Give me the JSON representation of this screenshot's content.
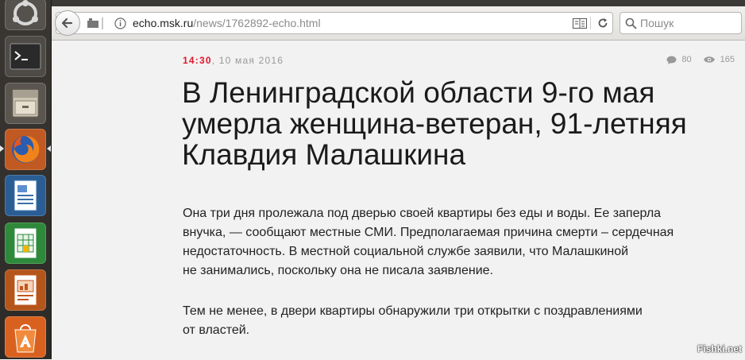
{
  "browser": {
    "url_host": "echo.msk.ru",
    "url_path": "/news/1762892-echo.html",
    "search_placeholder": "Пошук"
  },
  "article": {
    "time": "14:30",
    "date": ", 10 мая 2016",
    "comments_count": "80",
    "views_count": "165",
    "headline_lines": [
      "В Ленинградской области 9-го мая",
      "умерла женщина-ветеран, 91-летняя",
      "Клавдия Малашкина"
    ],
    "paragraph1_lines": [
      "Она три дня пролежала под дверью своей квартиры без еды и воды. Ее заперла",
      "внучка, — сообщают местные СМИ. Предполагаемая причина смерти – сердечная",
      "недостаточность. В местной социальной службе заявили, что Малашкиной",
      "не занимались, поскольку она не писала заявление."
    ],
    "paragraph2_lines": [
      "Тем не менее, в двери квартиры обнаружили три открытки с поздравлениями",
      "от властей."
    ]
  },
  "watermark": "Fishki.net",
  "launcher_icons": [
    "ubuntu-dash-icon",
    "terminal-icon",
    "file-manager-icon",
    "firefox-icon",
    "writer-icon",
    "calc-icon",
    "impress-icon",
    "software-center-icon"
  ],
  "colors": {
    "accent_time": "#e0152b",
    "launcher_bg": "#2f2d2a"
  }
}
